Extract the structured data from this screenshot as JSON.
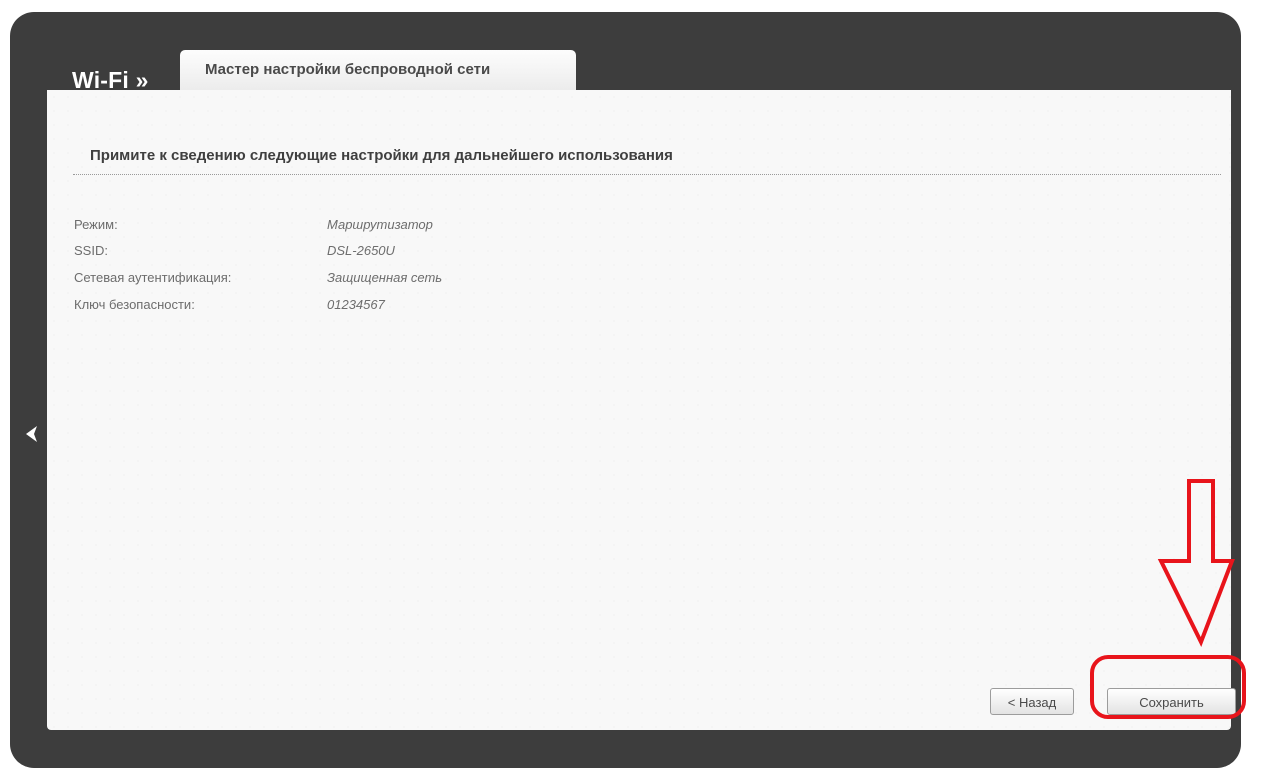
{
  "header": {
    "section_title": "Wi-Fi »",
    "tab_label": "Мастер настройки беспроводной сети"
  },
  "panel": {
    "heading": "Примите к сведению следующие настройки для дальнейшего использования",
    "settings": [
      {
        "label": "Режим:",
        "value": "Маршрутизатор"
      },
      {
        "label": "SSID:",
        "value": "DSL-2650U"
      },
      {
        "label": "Сетевая аутентификация:",
        "value": "Защищенная сеть"
      },
      {
        "label": "Ключ безопасности:",
        "value": "01234567"
      }
    ]
  },
  "buttons": {
    "back_label": "< Назад",
    "save_label": "Сохранить"
  },
  "icons": {
    "nav_left": "chevron-left-icon",
    "annotation_arrow": "down-arrow-icon",
    "annotation_highlight": "highlight-ellipse"
  },
  "colors": {
    "frame": "#3d3d3d",
    "panel": "#f8f8f8",
    "annotation": "#e8141b"
  }
}
